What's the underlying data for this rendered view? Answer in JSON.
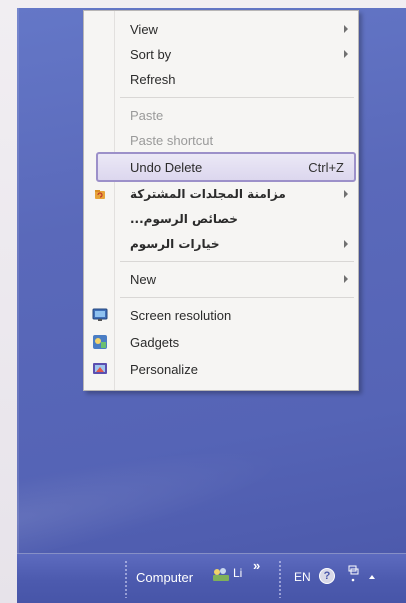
{
  "context_menu": {
    "view": "View",
    "sort_by": "Sort by",
    "refresh": "Refresh",
    "paste": "Paste",
    "paste_shortcut": "Paste shortcut",
    "undo_delete": "Undo Delete",
    "undo_delete_shortcut": "Ctrl+Z",
    "shared_folders_sync": "مزامنة المجلدات المشتركة",
    "graphics_properties": "خصائص الرسوم...",
    "graphics_options": "خيارات الرسوم",
    "new": "New",
    "screen_resolution": "Screen resolution",
    "gadgets": "Gadgets",
    "personalize": "Personalize"
  },
  "icons": {
    "sync": "sync-folder-icon",
    "screen_resolution": "screen-resolution-icon",
    "gadgets": "gadgets-icon",
    "personalize": "personalize-icon",
    "submenu": "chevron-right-icon"
  },
  "taskbar": {
    "toolbar_label": "Computer",
    "tray_app_label": "Li",
    "overflow": "»",
    "language": "EN",
    "help": "?"
  },
  "colors": {
    "desktop": "#5a69ba",
    "menu_bg": "#f6f5f3",
    "highlight_border": "#9c90c9",
    "highlight_fill": "#e3def2",
    "disabled_text": "#9a9a9a"
  }
}
